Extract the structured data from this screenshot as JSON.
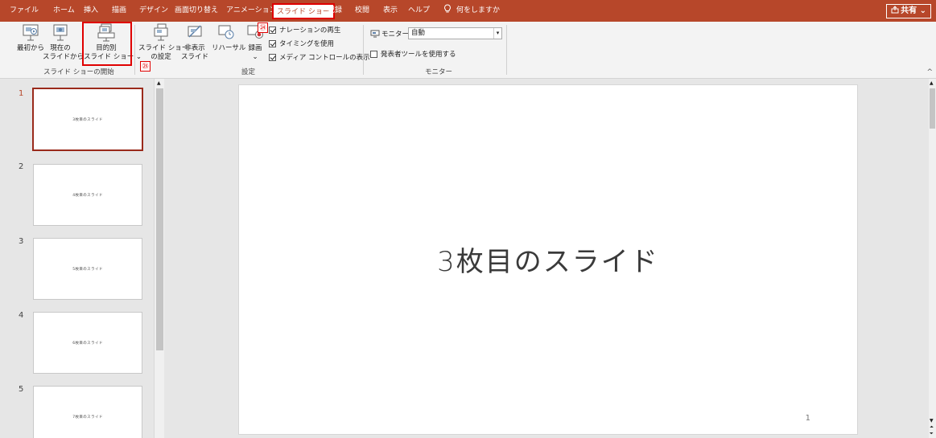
{
  "tabs": [
    "ファイル",
    "ホーム",
    "挿入",
    "描画",
    "デザイン",
    "画面切り替え",
    "アニメーション",
    "スライド ショー",
    "記録",
    "校閲",
    "表示",
    "ヘルプ"
  ],
  "tell_me": "何をしますか",
  "share_label": "共有",
  "ribbon": {
    "start_group": {
      "label": "スライド ショーの開始",
      "from_beginning": "最初から",
      "from_current_1": "現在の",
      "from_current_2": "スライドから",
      "custom_1": "目的別",
      "custom_2": "スライド ショー",
      "custom_caret": "⌄"
    },
    "setup_group": {
      "label": "設定",
      "setup_1": "スライド ショー",
      "setup_2": "の設定",
      "hide_1": "非表示",
      "hide_2": "スライド",
      "rehearse": "リハーサル",
      "record": "録画",
      "record_caret": "⌄",
      "narration": "ナレーションの再生",
      "timings": "タイミングを使用",
      "media_controls": "メディア コントロールの表示"
    },
    "monitor_group": {
      "label": "モニター",
      "monitor_label": "モニター:",
      "monitor_value": "自動",
      "presenter_view": "発表者ツールを使用する"
    }
  },
  "callouts": {
    "c24": "㉔",
    "c25": "㉕"
  },
  "thumbnails": [
    {
      "number": "1",
      "text": "3枚目のスライド"
    },
    {
      "number": "2",
      "text": "4枚目のスライド"
    },
    {
      "number": "3",
      "text": "5枚目のスライド"
    },
    {
      "number": "4",
      "text": "6枚目のスライド"
    },
    {
      "number": "5",
      "text": "7枚目のスライド"
    }
  ],
  "slide": {
    "title": "3枚目のスライド",
    "page_number": "1"
  },
  "colors": {
    "accent": "#b7472a",
    "highlight": "#e00000"
  }
}
